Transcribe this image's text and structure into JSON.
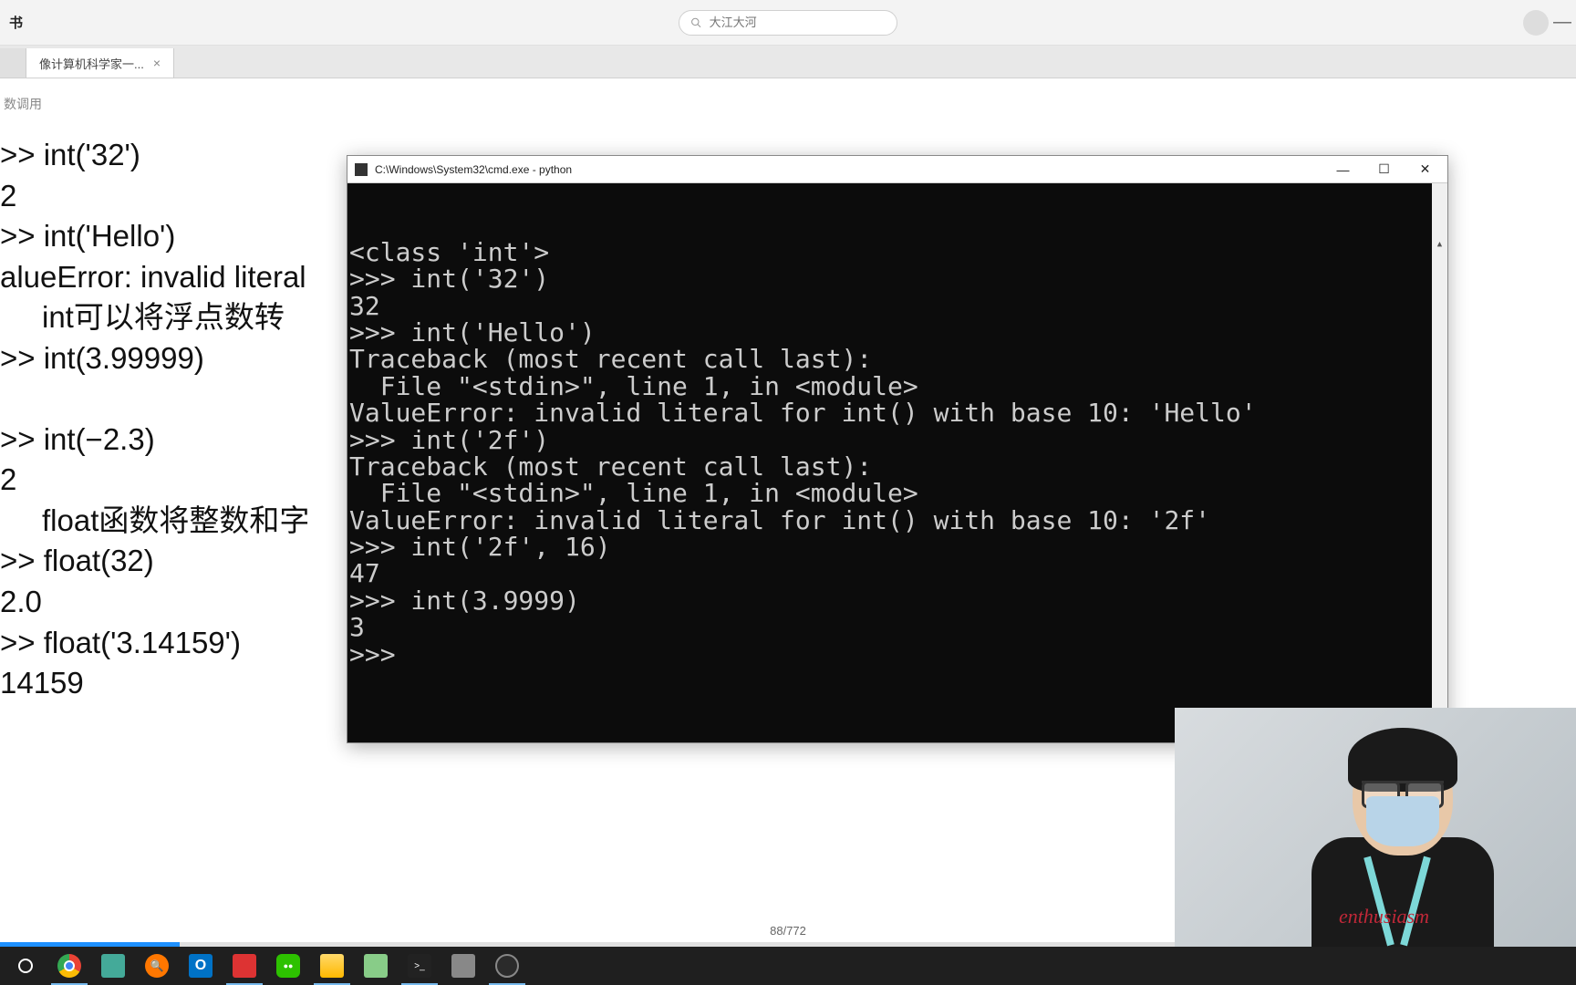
{
  "app": {
    "title_suffix": "书"
  },
  "search": {
    "placeholder": "大江大河"
  },
  "tabs": [
    {
      "label": "",
      "active": false
    },
    {
      "label": "像计算机科学家一...",
      "active": true
    }
  ],
  "breadcrumb": "数调用",
  "doc_lines": [
    {
      "text": ">> int('32')",
      "indent": false
    },
    {
      "text": "2",
      "indent": false
    },
    {
      "text": ">> int('Hello')",
      "indent": false
    },
    {
      "text": "alueError: invalid literal",
      "indent": false
    },
    {
      "text": "int可以将浮点数转",
      "indent": true
    },
    {
      "text": ">> int(3.99999)",
      "indent": false
    },
    {
      "text": "",
      "indent": false
    },
    {
      "text": ">> int(−2.3)",
      "indent": false
    },
    {
      "text": "2",
      "indent": false
    },
    {
      "text": "float函数将整数和字",
      "indent": true
    },
    {
      "text": ">> float(32)",
      "indent": false
    },
    {
      "text": "2.0",
      "indent": false
    },
    {
      "text": ">> float('3.14159')",
      "indent": false
    },
    {
      "text": "14159",
      "indent": false
    }
  ],
  "page_counter": "88/772",
  "terminal": {
    "title": "C:\\Windows\\System32\\cmd.exe - python",
    "lines": [
      "<class 'int'>",
      ">>> int('32')",
      "32",
      ">>> int('Hello')",
      "Traceback (most recent call last):",
      "  File \"<stdin>\", line 1, in <module>",
      "ValueError: invalid literal for int() with base 10: 'Hello'",
      ">>> int('2f')",
      "Traceback (most recent call last):",
      "  File \"<stdin>\", line 1, in <module>",
      "ValueError: invalid literal for int() with base 10: '2f'",
      ">>> int('2f', 16)",
      "47",
      ">>> int(3.9999)",
      "3",
      ">>>"
    ]
  },
  "camera_shirt_text": "enthusiasm",
  "taskbar_icons": [
    {
      "name": "start",
      "color": "#fff",
      "active": false
    },
    {
      "name": "chrome",
      "color": "#fff",
      "active": true
    },
    {
      "name": "app-green",
      "color": "#4a9",
      "active": false
    },
    {
      "name": "everything",
      "color": "#f60",
      "active": false
    },
    {
      "name": "outlook",
      "color": "#0072c6",
      "active": false
    },
    {
      "name": "app-red",
      "color": "#d33",
      "active": true
    },
    {
      "name": "wechat",
      "color": "#2dc100",
      "active": false
    },
    {
      "name": "explorer",
      "color": "#ffb900",
      "active": true
    },
    {
      "name": "notepad",
      "color": "#8c8",
      "active": false
    },
    {
      "name": "cmd",
      "color": "#333",
      "active": true
    },
    {
      "name": "app-gray",
      "color": "#888",
      "active": false
    },
    {
      "name": "obs",
      "color": "#333",
      "active": true
    }
  ]
}
